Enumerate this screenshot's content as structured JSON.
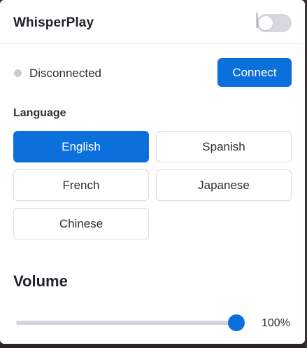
{
  "header": {
    "title": "WhisperPlay",
    "toggle_on": false
  },
  "connection": {
    "status": "Disconnected",
    "connect_label": "Connect"
  },
  "language": {
    "label": "Language",
    "options": [
      "English",
      "Spanish",
      "French",
      "Japanese",
      "Chinese"
    ],
    "selected": "English"
  },
  "volume": {
    "label": "Volume",
    "value_text": "100%",
    "level_percent": 100
  },
  "colors": {
    "accent": "#0b6fdc",
    "status_dot": "#c8ccd2",
    "toggle_off": "#d5d9df"
  }
}
